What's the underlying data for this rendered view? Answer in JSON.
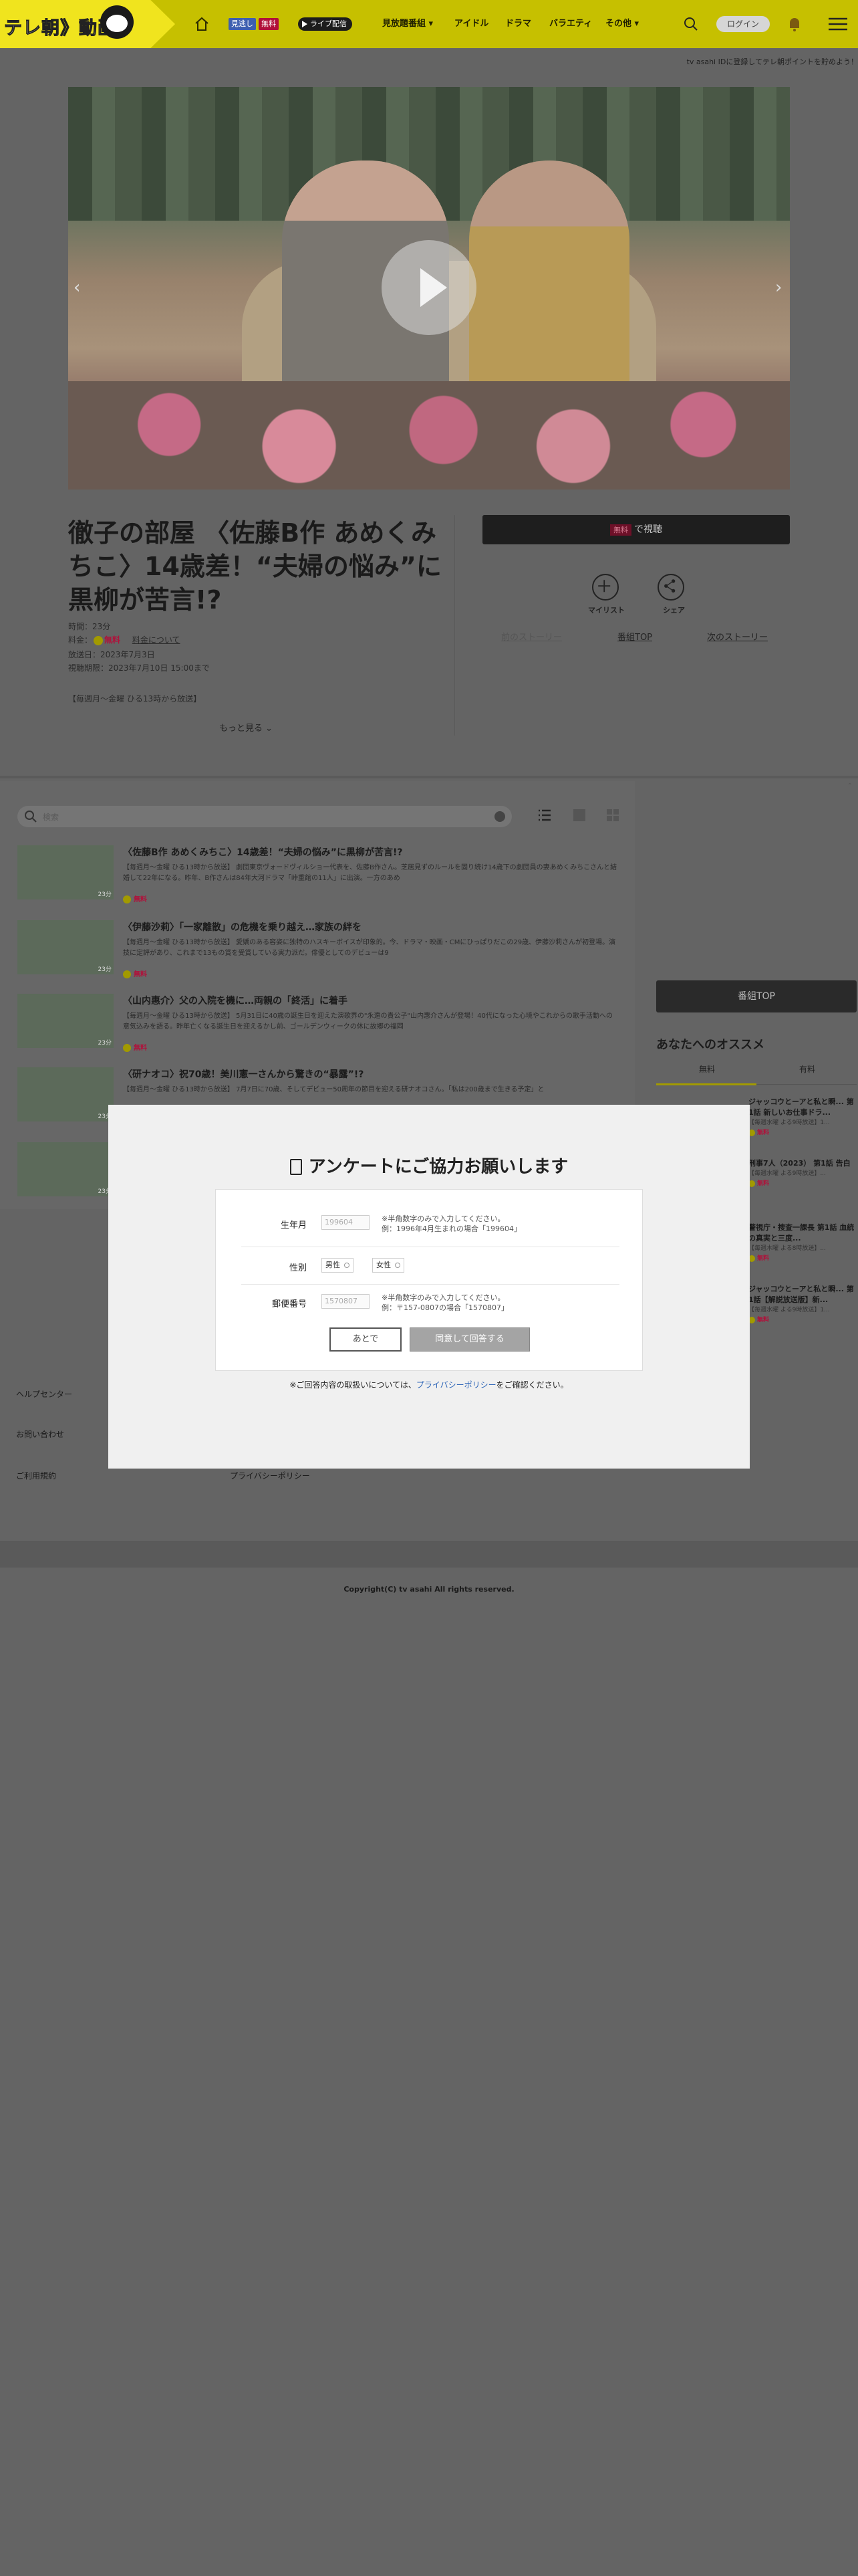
{
  "header": {
    "logo_text": "テレ朝",
    "logo_sep": "》",
    "logo_sub": "動画",
    "badge_live": "見逃し",
    "badge_free": "無料",
    "badge_livestream": "ライブ配信",
    "nav": [
      "見放題番組",
      "アイドル",
      "ドラマ",
      "バラエティ",
      "その他"
    ],
    "login": "ログイン"
  },
  "notice": "tv asahi IDに登録してテレ朝ポイントを貯めよう！",
  "episode": {
    "title": "徹子の部屋 〈佐藤B作 あめくみちこ〉14歳差！“夫婦の悩み”に黒柳が苦言!?",
    "duration": "時間：23分",
    "price_label": "料金：",
    "price_free": "無料",
    "price_link": "料金について",
    "air_date": "放送日：2023年7月3日",
    "expire": "視聴期限：2023年7月10日 15:00まで",
    "schedule": "【毎週月～金曜 ひる13時から放送】",
    "more": "もっと見る"
  },
  "actions": {
    "watch_free": "無料",
    "watch_label": "で視聴",
    "mylist": "マイリスト",
    "share": "シェア",
    "prev_story": "前のストーリー",
    "program_top": "番組TOP",
    "next_story": "次のストーリー"
  },
  "search": {
    "placeholder": "検索"
  },
  "episodes": [
    {
      "title": "〈佐藤B作 あめくみちこ〉14歳差！“夫婦の悩み”に黒柳が苦言!?",
      "desc": "【毎週月～金曜 ひる13時から放送】 劇団東京ヴォードヴィルショー代表を、佐藤B作さん。芝居見ずのルールを固り続け14歳下の劇団員の妻あめくみちこさんと結婚して22年になる。昨年、B作さんは84年大河ドラマ「峠重館の11人」に出演。一方のあめ",
      "free": "無料",
      "time": "23分"
    },
    {
      "title": "〈伊藤沙莉〉「一家離散」の危機を乗り越え…家族の絆を",
      "desc": "【毎週月～金曜 ひる13時から放送】 愛嬌のある容姿に独特のハスキーボイスが印象的。今、ドラマ・映画・CMにひっぱりだこの29歳、伊藤沙莉さんが初登場。演技に定評があり、これまで13もの賞を受賞している実力派だ。俳優としてのデビューは9",
      "free": "無料",
      "time": "23分"
    },
    {
      "title": "〈山内惠介〉父の入院を機に…両親の「終活」に着手",
      "desc": "【毎週月～金曜 ひる13時から放送】 5月31日に40歳の誕生日を迎えた演歌界の\"永遠の貴公子\"山内惠介さんが登場！40代になった心境やこれからの歌手活動への意気込みを語る。昨年亡くなる誕生日を迎えるかし前、ゴールデンウィークの休に故郷の福岡",
      "free": "無料",
      "time": "23分"
    },
    {
      "title": "〈研ナオコ〉祝70歳！美川憲一さんから驚きの“暴露”!?",
      "desc": "【毎週月～金曜 ひる13時から放送】 7月7日に70歳、そしてデビュー50周年の節目を迎える研ナオコさん。「私は200歳まで生きる予定」と",
      "free": "無料",
      "time": "23分"
    },
    {
      "title": "",
      "desc": "",
      "free": "",
      "time": "23分"
    }
  ],
  "sidebar": {
    "program_top": "番組TOP",
    "rec_heading": "あなたへのオススメ",
    "tab_free": "無料",
    "tab_pay": "有料",
    "recs": [
      {
        "title": "ジャッコウとーアと私と瞬... 第1話 新しいお仕事ドラ...",
        "desc": "【毎週水曜 よる9時放送】1...",
        "free": "無料"
      },
      {
        "title": "刑事7人（2023） 第1話 告白",
        "desc": "【毎週水曜 よる9時放送】...",
        "free": "無料"
      },
      {
        "title": "警視庁・捜査一課長 第1話 血統の真実と三度...",
        "desc": "【毎週木曜 よる8時放送】...",
        "free": "無料"
      },
      {
        "title": "ジャッコウとーアと私と瞬... 第1話【解説放送版】新...",
        "desc": "【毎週水曜 よる9時放送】1...",
        "free": "無料"
      }
    ]
  },
  "footer": {
    "help": "ヘルプセンター",
    "contact": "お問い合わせ",
    "terms": "ご利用規約",
    "privacy": "プライバシーポリシー",
    "copyright": "Copyright(C) tv asahi All rights reserved."
  },
  "survey": {
    "title": "アンケートにご協力お願いします",
    "birth_label": "生年月",
    "birth_placeholder": "199604",
    "birth_hint1": "※半角数字のみで入力してください。",
    "birth_hint2": "例：1996年4月生まれの場合「199604」",
    "gender_label": "性別",
    "gender_male": "男性",
    "gender_female": "女性",
    "zip_label": "郵便番号",
    "zip_placeholder": "1570807",
    "zip_hint1": "※半角数字のみで入力してください。",
    "zip_hint2": "例：〒157-0807の場合「1570807」",
    "later": "あとで",
    "agree": "同意して回答する",
    "note_pre": "※ご回答内容の取扱いについては、",
    "note_link": "プライバシーポリシー",
    "note_post": "をご確認ください。"
  }
}
